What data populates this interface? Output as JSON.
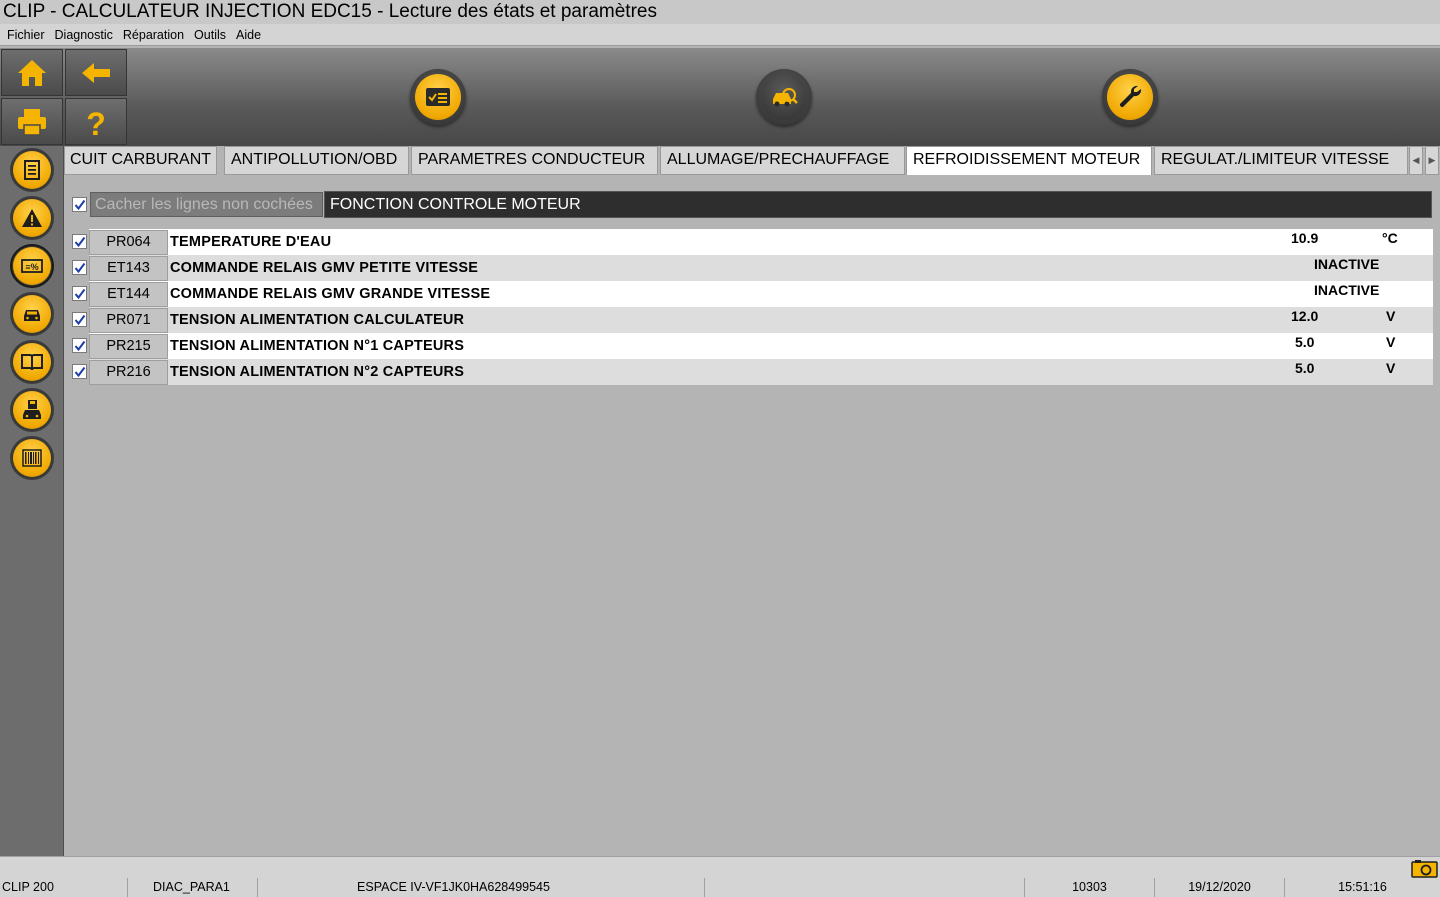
{
  "window": {
    "title": "CLIP - CALCULATEUR INJECTION EDC15 - Lecture des états et paramètres"
  },
  "menu": [
    "Fichier",
    "Diagnostic",
    "Réparation",
    "Outils",
    "Aide"
  ],
  "toolbar": {
    "left_buttons": [
      "home-icon",
      "back-arrow-icon",
      "print-icon",
      "help-icon"
    ],
    "center_buttons": [
      "checklist-icon",
      "vehicle-diagnostic-icon",
      "wrench-icon"
    ]
  },
  "sidebar": [
    "report-icon",
    "warning-icon",
    "parameters-icon",
    "vehicle-icon",
    "manual-icon",
    "vehicle-save-icon",
    "barcode-icon"
  ],
  "tabs": [
    {
      "label": "CUIT CARBURANT",
      "active": false
    },
    {
      "label": "ANTIPOLLUTION/OBD",
      "active": false
    },
    {
      "label": "PARAMETRES CONDUCTEUR",
      "active": false
    },
    {
      "label": "ALLUMAGE/PRECHAUFFAGE",
      "active": false
    },
    {
      "label": "REFROIDISSEMENT MOTEUR",
      "active": true
    },
    {
      "label": "REGULAT./LIMITEUR VITESSE",
      "active": false
    }
  ],
  "content": {
    "hide_unchecked_label": "Cacher les lignes non cochées",
    "hide_unchecked_checked": true,
    "function_header": "FONCTION CONTROLE MOTEUR",
    "rows": [
      {
        "checked": true,
        "code": "PR064",
        "label": "TEMPERATURE D'EAU",
        "value": "10.9",
        "unit": "°C"
      },
      {
        "checked": true,
        "code": "ET143",
        "label": "COMMANDE RELAIS GMV PETITE VITESSE",
        "value": "INACTIVE",
        "unit": ""
      },
      {
        "checked": true,
        "code": "ET144",
        "label": "COMMANDE RELAIS GMV GRANDE VITESSE",
        "value": "INACTIVE",
        "unit": ""
      },
      {
        "checked": true,
        "code": "PR071",
        "label": "TENSION ALIMENTATION CALCULATEUR",
        "value": "12.0",
        "unit": "V"
      },
      {
        "checked": true,
        "code": "PR215",
        "label": "TENSION ALIMENTATION N°1 CAPTEURS",
        "value": "5.0",
        "unit": "V"
      },
      {
        "checked": true,
        "code": "PR216",
        "label": "TENSION ALIMENTATION N°2 CAPTEURS",
        "value": "5.0",
        "unit": "V"
      }
    ]
  },
  "statusbar": {
    "product": "CLIP 200",
    "screen": "DIAC_PARA1",
    "vehicle": "ESPACE IV-VF1JK0HA628499545",
    "empty": "",
    "code": "10303",
    "date": "19/12/2020",
    "time": "15:51:16"
  },
  "colors": {
    "accent_yellow": "#f5b400",
    "header_dark": "#2e2e2e",
    "toolbar_grey": "#5a5a5a"
  }
}
